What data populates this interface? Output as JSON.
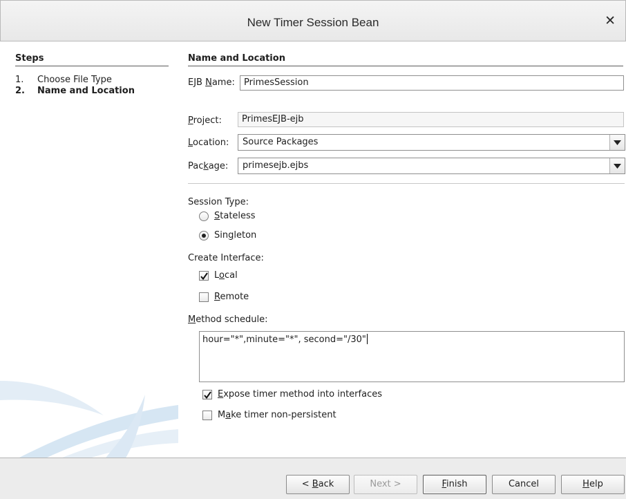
{
  "dialog": {
    "title": "New Timer Session Bean"
  },
  "steps": {
    "heading": "Steps",
    "items": [
      {
        "num": "1.",
        "label": "Choose File Type"
      },
      {
        "num": "2.",
        "label": "Name and Location"
      }
    ]
  },
  "section": {
    "heading": "Name and Location"
  },
  "ejb_name": {
    "label_pre": "EJB ",
    "label_mn": "N",
    "label_post": "ame:",
    "value": "PrimesSession"
  },
  "project": {
    "label_mn": "P",
    "label_post": "roject:",
    "value": "PrimesEJB-ejb"
  },
  "location": {
    "label_mn": "L",
    "label_post": "ocation:",
    "value": "Source Packages"
  },
  "package": {
    "label_pre": "Pac",
    "label_mn": "k",
    "label_post": "age:",
    "value": "primesejb.ejbs"
  },
  "session_type": {
    "label": "Session Type:",
    "options": [
      {
        "pre": "",
        "mn": "S",
        "post": "tateless",
        "selected": false
      },
      {
        "pre": "Sin",
        "mn": "g",
        "post": "leton",
        "selected": true
      }
    ]
  },
  "create_interface": {
    "label": "Create Interface:",
    "options": [
      {
        "pre": "L",
        "mn": "o",
        "post": "cal",
        "checked": true
      },
      {
        "pre": "",
        "mn": "R",
        "post": "emote",
        "checked": false
      }
    ]
  },
  "method_schedule": {
    "label_mn": "M",
    "label_post": "ethod schedule:",
    "value": "hour=\"*\",minute=\"*\", second=\"/30\""
  },
  "expose": {
    "pre": "",
    "mn": "E",
    "post": "xpose timer method into interfaces",
    "checked": true
  },
  "nonpersistent": {
    "pre": "M",
    "mn": "a",
    "post": "ke timer non-persistent",
    "checked": false
  },
  "buttons": {
    "back": {
      "pre": "< ",
      "mn": "B",
      "post": "ack"
    },
    "next": {
      "label": "Next >"
    },
    "finish": {
      "pre": "",
      "mn": "F",
      "post": "inish"
    },
    "cancel": {
      "label": "Cancel"
    },
    "help": {
      "pre": "",
      "mn": "H",
      "post": "elp"
    }
  }
}
